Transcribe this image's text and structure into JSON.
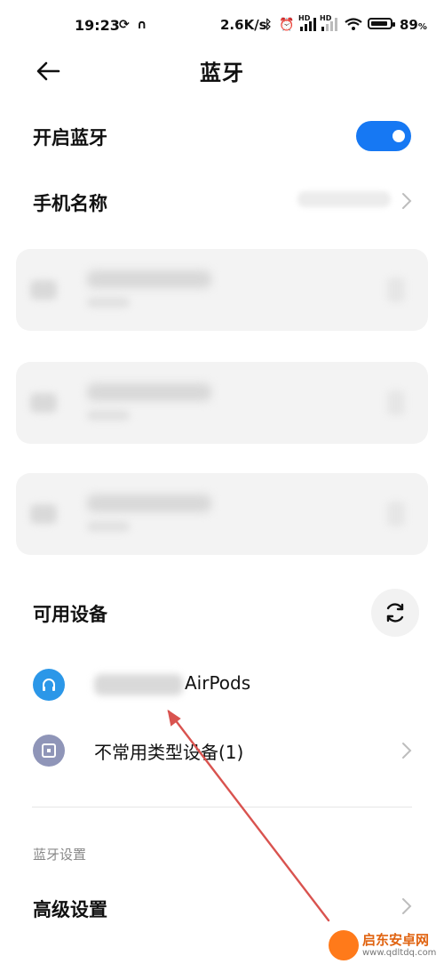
{
  "status_bar": {
    "time": "19:23",
    "net_speed": "2.6K/s",
    "signal_badge_1": "HD",
    "signal_badge_2": "HD",
    "battery_percent": "89",
    "battery_unit": "%",
    "battery_level": 0.89,
    "icons": [
      "sync-icon",
      "headset-icon",
      "bluetooth-icon",
      "alarm-icon",
      "signal-icon",
      "signal-icon",
      "wifi-icon",
      "battery-icon"
    ]
  },
  "header": {
    "title": "蓝牙",
    "back_icon": "back-arrow-icon"
  },
  "bluetooth_toggle": {
    "label": "开启蓝牙",
    "on": true,
    "accent": "#1678f3"
  },
  "phone_name": {
    "label": "手机名称"
  },
  "paired_devices": [
    {
      "icon": "headset-icon"
    },
    {
      "icon": "headset-icon"
    },
    {
      "icon": "headset-icon"
    }
  ],
  "available": {
    "section_title": "可用设备",
    "refresh_icon": "refresh-icon",
    "devices": [
      {
        "name": "AirPods",
        "icon": "headphones-icon",
        "icon_color": "#2b97e8"
      },
      {
        "name": "不常用类型设备(1)",
        "icon": "device-icon",
        "icon_color": "#8f95b8"
      }
    ]
  },
  "settings": {
    "section_title": "蓝牙设置",
    "advanced_label": "高级设置"
  },
  "watermark": {
    "name": "启东安卓网",
    "url": "www.qdltdq.com"
  }
}
